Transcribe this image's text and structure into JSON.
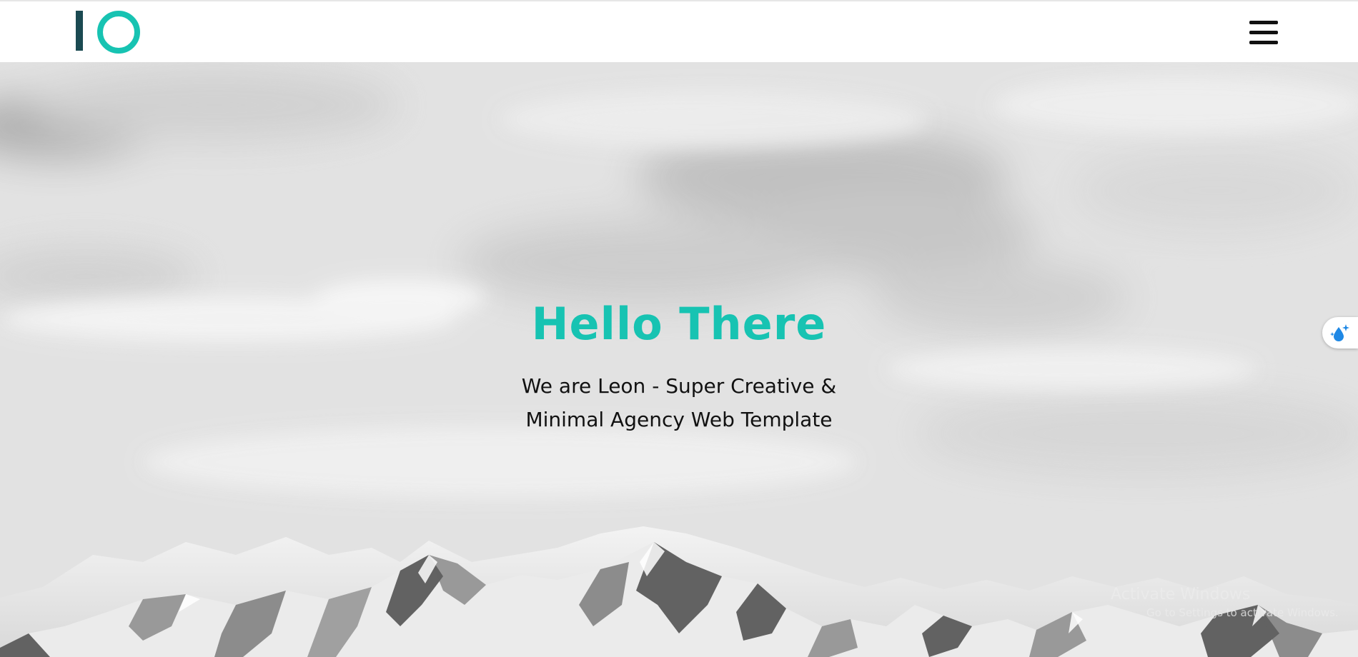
{
  "header": {
    "logo_name": "IO logo",
    "menu_icon": "hamburger-menu-icon"
  },
  "hero": {
    "title": "Hello There",
    "subtitle_line1": "We are Leon - Super Creative &",
    "subtitle_line2": "Minimal Agency Web Template",
    "background": "grayscale-mountain-sky-photo"
  },
  "side_widget": {
    "icon": "water-drop-sparkle-icon"
  },
  "watermark": {
    "title": "Activate Windows",
    "subtitle": "Go to Settings to activate Windows."
  },
  "colors": {
    "accent": "#17c3b2",
    "logo_bar": "#1b4a52",
    "text": "#111111",
    "header_bg": "#ffffff"
  }
}
